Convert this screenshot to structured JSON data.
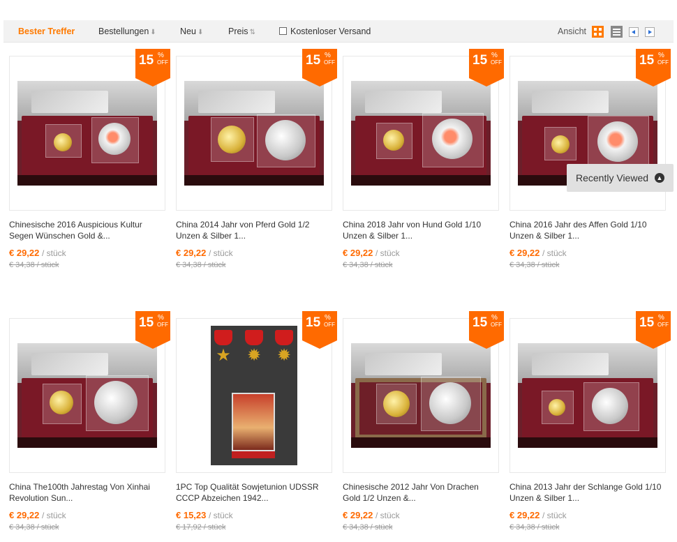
{
  "sortbar": {
    "items": [
      "Bester Treffer",
      "Bestellungen",
      "Neu",
      "Preis"
    ],
    "free_shipping_label": "Kostenloser Versand",
    "view_label": "Ansicht"
  },
  "products": [
    {
      "discount": "15",
      "title": "Chinesische 2016 Auspicious Kultur Segen Wünschen Gold &...",
      "price": "€ 29,22",
      "unit": "/ stück",
      "old_price": "€ 34,38 / stück"
    },
    {
      "discount": "15",
      "title": "China 2014 Jahr von Pferd Gold 1/2 Unzen & Silber 1...",
      "price": "€ 29,22",
      "unit": "/ stück",
      "old_price": "€ 34,38 / stück"
    },
    {
      "discount": "15",
      "title": "China 2018 Jahr von Hund Gold 1/10 Unzen & Silber 1...",
      "price": "€ 29,22",
      "unit": "/ stück",
      "old_price": "€ 34,38 / stück"
    },
    {
      "discount": "15",
      "title": "China 2016 Jahr des Affen Gold 1/10 Unzen & Silber 1...",
      "price": "€ 29,22",
      "unit": "/ stück",
      "old_price": "€ 34,38 / stück"
    },
    {
      "discount": "15",
      "title": "China The100th Jahrestag Von Xinhai Revolution Sun...",
      "price": "€ 29,22",
      "unit": "/ stück",
      "old_price": "€ 34,38 / stück"
    },
    {
      "discount": "15",
      "title": "1PC Top Qualität Sowjetunion UDSSR CCCP Abzeichen 1942...",
      "price": "€ 15,23",
      "unit": "/ stück",
      "old_price": "€ 17,92 / stück"
    },
    {
      "discount": "15",
      "title": "Chinesische 2012 Jahr Von Drachen Gold 1/2 Unzen &...",
      "price": "€ 29,22",
      "unit": "/ stück",
      "old_price": "€ 34,38 / stück"
    },
    {
      "discount": "15",
      "title": "China 2013 Jahr der Schlange Gold 1/10 Unzen & Silber 1...",
      "price": "€ 29,22",
      "unit": "/ stück",
      "old_price": "€ 34,38 / stück"
    }
  ],
  "badge": {
    "percent": "%",
    "off": "OFF"
  },
  "recently_viewed": "Recently Viewed",
  "colors": {
    "accent": "#ff6a00",
    "bar": "#f2f2f2"
  }
}
